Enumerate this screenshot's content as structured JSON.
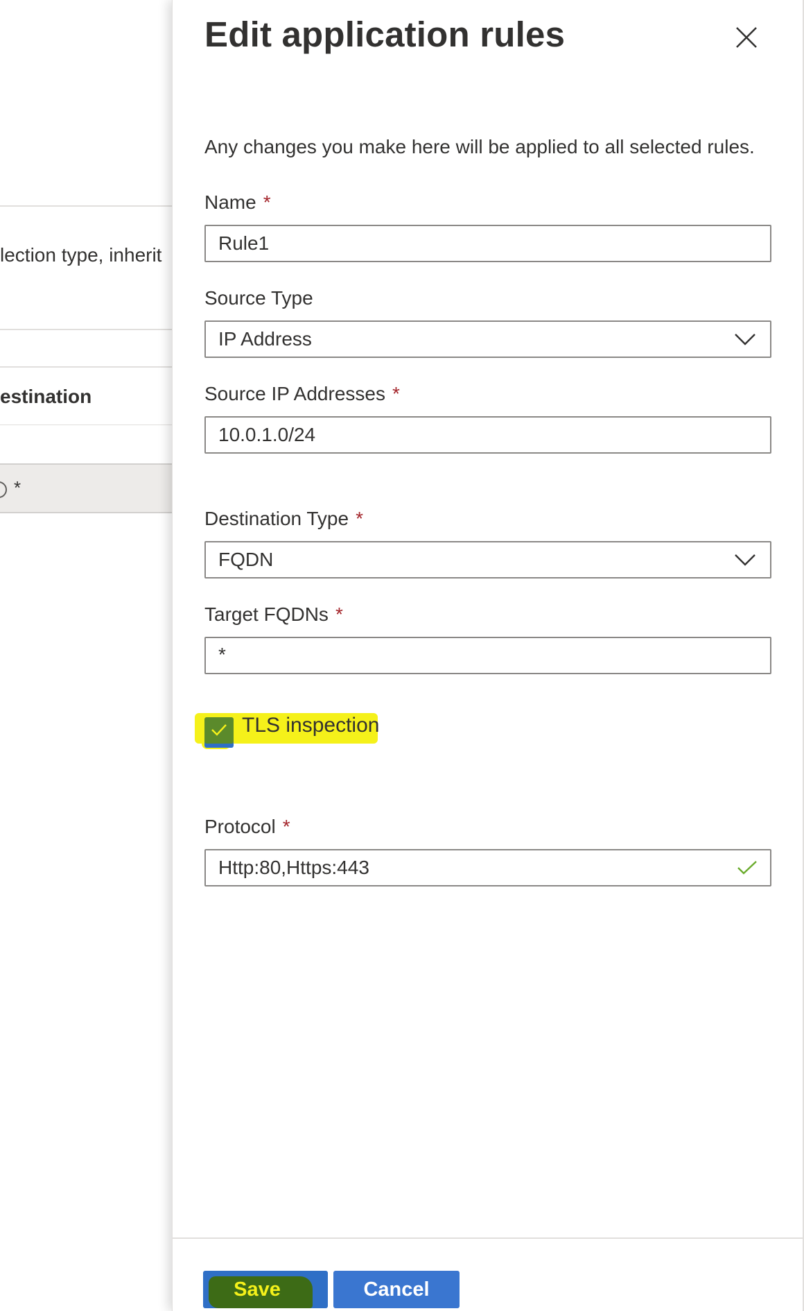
{
  "background_page": {
    "row_text": "lection type, inherit",
    "column_header": "estination",
    "selected_row_value": "*"
  },
  "panel": {
    "title": "Edit application rules",
    "description": "Any changes you make here will be applied to all selected rules.",
    "close_icon": "close-icon"
  },
  "fields": {
    "name": {
      "label": "Name",
      "required_marker": "*",
      "value": "Rule1"
    },
    "source_type": {
      "label": "Source Type",
      "value": "IP Address",
      "icon": "chevron-down-icon"
    },
    "source_ip": {
      "label": "Source IP Addresses",
      "required_marker": "*",
      "value": "10.0.1.0/24"
    },
    "destination_type": {
      "label": "Destination Type",
      "required_marker": "*",
      "value": "FQDN",
      "icon": "chevron-down-icon"
    },
    "target_fqdns": {
      "label": "Target FQDNs",
      "required_marker": "*",
      "value": "*"
    },
    "tls_inspection": {
      "label": "TLS inspection",
      "checked": true
    },
    "protocol": {
      "label": "Protocol",
      "required_marker": "*",
      "value": "Http:80,Https:443",
      "icon": "checkmark-icon"
    }
  },
  "footer": {
    "save_label": "Save",
    "cancel_label": "Cancel"
  },
  "colors": {
    "required": "#a4262c",
    "primary_button": "#2f6fc6",
    "highlight": "#f5f11a",
    "checkbox_fill": "#5b8a2b",
    "valid_check": "#6aab2c"
  }
}
